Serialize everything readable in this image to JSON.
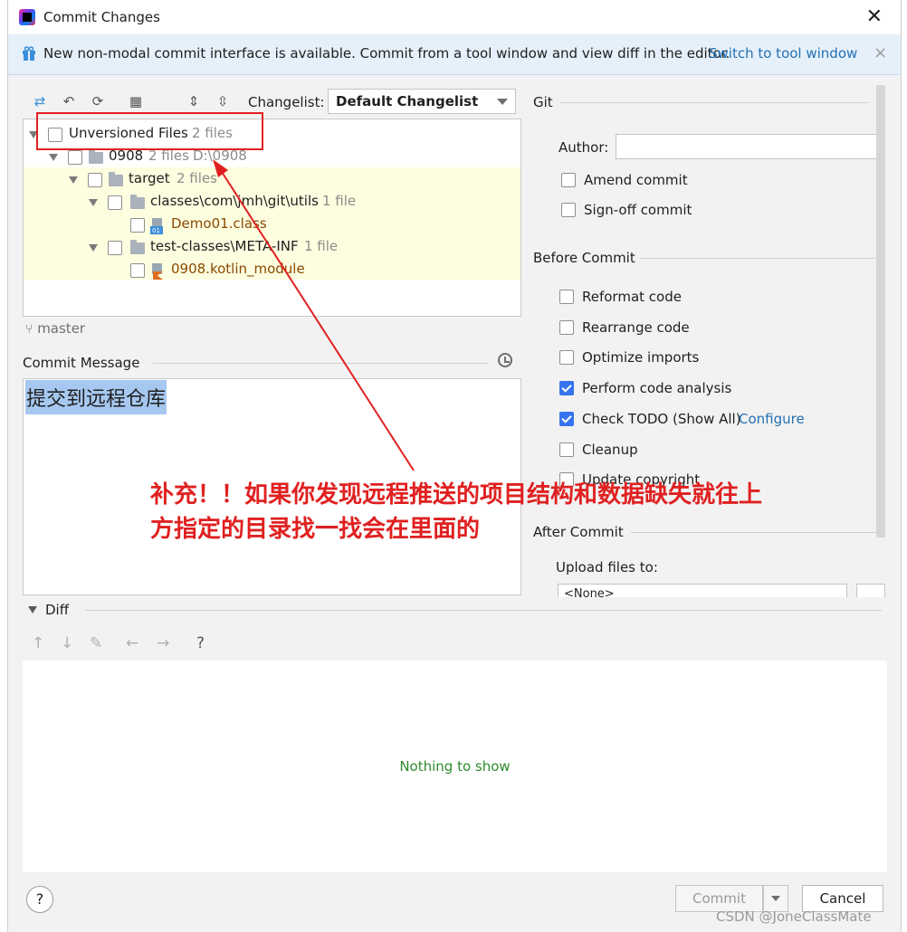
{
  "window": {
    "title": "Commit Changes"
  },
  "banner": {
    "text": "New non-modal commit interface is available. Commit from a tool window and view diff in the editor.",
    "link": "Switch to tool window",
    "close": "×"
  },
  "toolbar": {
    "changelist_label": "Changelist:",
    "changelist_value": "Default Changelist"
  },
  "tree": {
    "root": {
      "label": "Unversioned Files",
      "count": "2 files"
    },
    "project": {
      "label": "0908",
      "count": "2 files",
      "path": "D:\\0908"
    },
    "target": {
      "label": "target",
      "count": "2 files"
    },
    "classes": {
      "label": "classes\\com\\jmh\\git\\utils",
      "count": "1 file"
    },
    "file1": {
      "label": "Demo01.class"
    },
    "test_classes": {
      "label": "test-classes\\META-INF",
      "count": "1 file"
    },
    "file2": {
      "label": "0908.kotlin_module"
    }
  },
  "branch": "master",
  "commit_message": {
    "label": "Commit Message",
    "text": "提交到远程仓库"
  },
  "annotation": {
    "line1": "补充！！如果你发现远程推送的项目结构和数据缺失就往上",
    "line2": "方指定的目录找一找会在里面的"
  },
  "git": {
    "title": "Git",
    "author_label": "Author:",
    "author_value": "",
    "amend": "Amend commit",
    "signoff": "Sign-off commit"
  },
  "before_commit": {
    "title": "Before Commit",
    "options": [
      {
        "label": "Reformat code",
        "checked": false
      },
      {
        "label": "Rearrange code",
        "checked": false
      },
      {
        "label": "Optimize imports",
        "checked": false
      },
      {
        "label": "Perform code analysis",
        "checked": true
      },
      {
        "label": "Check TODO (Show All)",
        "checked": true
      },
      {
        "label": "Cleanup",
        "checked": false
      },
      {
        "label": "Update copyright",
        "checked": false
      }
    ],
    "configure_link": "Configure"
  },
  "after_commit": {
    "title": "After Commit",
    "upload_label": "Upload files to:",
    "upload_value": "<None>"
  },
  "diff": {
    "label": "Diff",
    "empty": "Nothing to show",
    "help": "?"
  },
  "buttons": {
    "help": "?",
    "commit": "Commit",
    "cancel": "Cancel"
  },
  "watermark": "CSDN @JoneClassMate",
  "colors": {
    "accent": "#3574f0",
    "link": "#2470b3",
    "annotation": "#e02020",
    "banner_bg": "#e5f0fa"
  }
}
